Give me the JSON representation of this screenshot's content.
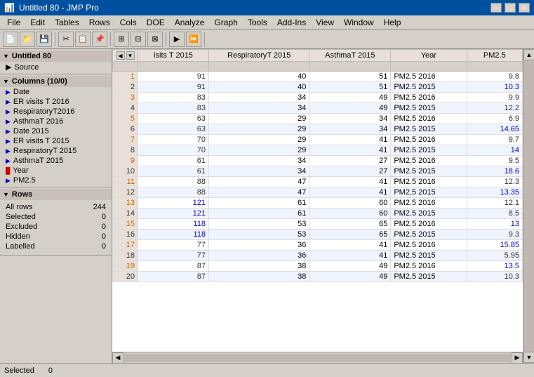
{
  "titleBar": {
    "title": "Untitled 80 - JMP Pro",
    "minBtn": "─",
    "maxBtn": "□",
    "closeBtn": "✕"
  },
  "menuBar": {
    "items": [
      "File",
      "Edit",
      "Tables",
      "Rows",
      "Cols",
      "DOE",
      "Analyze",
      "Graph",
      "Tools",
      "Add-Ins",
      "View",
      "Window",
      "Help"
    ]
  },
  "leftPanel": {
    "untitled": "Untitled 80",
    "source": "Source",
    "columnsHeader": "Columns (10/0)",
    "columns": [
      {
        "name": "Date",
        "icon": "tri-blue"
      },
      {
        "name": "ER visits T 2016",
        "icon": "tri-blue"
      },
      {
        "name": "RespiratoryT2016",
        "icon": "tri-blue"
      },
      {
        "name": "AsthmaT 2016",
        "icon": "tri-blue"
      },
      {
        "name": "Date 2015",
        "icon": "tri-blue"
      },
      {
        "name": "ER visits T 2015",
        "icon": "tri-blue"
      },
      {
        "name": "RespiratoryT 2015",
        "icon": "tri-blue"
      },
      {
        "name": "AsthmaT 2015",
        "icon": "tri-blue"
      },
      {
        "name": "Year",
        "icon": "bar-red"
      },
      {
        "name": "PM2.5",
        "icon": "tri-green"
      }
    ],
    "rowsHeader": "Rows",
    "rowStats": [
      {
        "label": "All rows",
        "value": 244
      },
      {
        "label": "Selected",
        "value": 0
      },
      {
        "label": "Excluded",
        "value": 0
      },
      {
        "label": "Hidden",
        "value": 0
      },
      {
        "label": "Labelled",
        "value": 0
      }
    ]
  },
  "table": {
    "headers": [
      "",
      "isits T 2015",
      "RespiratoryT 2015",
      "AsthmaT 2015",
      "Year",
      "PM2.5"
    ],
    "rows": [
      {
        "num": 1,
        "er": 91,
        "resp": 40,
        "asthma": 51,
        "year": "PM2.5 2016",
        "pm": 9.8,
        "numColor": "orange"
      },
      {
        "num": 2,
        "er": 91,
        "resp": 40,
        "asthma": 51,
        "year": "PM2.5 2015",
        "pm": 10.3,
        "numColor": "normal",
        "pmColor": "blue"
      },
      {
        "num": 3,
        "er": 83,
        "resp": 34,
        "asthma": 49,
        "year": "PM2.5 2016",
        "pm": 9.9,
        "numColor": "orange"
      },
      {
        "num": 4,
        "er": 83,
        "resp": 34,
        "asthma": 49,
        "year": "PM2.5 2015",
        "pm": 12.2,
        "numColor": "normal"
      },
      {
        "num": 5,
        "er": 63,
        "resp": 29,
        "asthma": 34,
        "year": "PM2.5 2016",
        "pm": 6.9,
        "numColor": "orange"
      },
      {
        "num": 6,
        "er": 63,
        "resp": 29,
        "asthma": 34,
        "year": "PM2.5 2015",
        "pm": 14.65,
        "numColor": "normal",
        "pmColor": "blue"
      },
      {
        "num": 7,
        "er": 70,
        "resp": 29,
        "asthma": 41,
        "year": "PM2.5 2016",
        "pm": 9.7,
        "numColor": "orange"
      },
      {
        "num": 8,
        "er": 70,
        "resp": 29,
        "asthma": 41,
        "year": "PM2.5 2015",
        "pm": 14,
        "numColor": "normal",
        "pmColor": "blue"
      },
      {
        "num": 9,
        "er": 61,
        "resp": 34,
        "asthma": 27,
        "year": "PM2.5 2016",
        "pm": 9.5,
        "numColor": "orange"
      },
      {
        "num": 10,
        "er": 61,
        "resp": 34,
        "asthma": 27,
        "year": "PM2.5 2015",
        "pm": 18.6,
        "numColor": "normal",
        "pmColor": "blue"
      },
      {
        "num": 11,
        "er": 88,
        "resp": 47,
        "asthma": 41,
        "year": "PM2.5 2016",
        "pm": 12.3,
        "numColor": "orange"
      },
      {
        "num": 12,
        "er": 88,
        "resp": 47,
        "asthma": 41,
        "year": "PM2.5 2015",
        "pm": 13.35,
        "numColor": "normal",
        "pmColor": "blue"
      },
      {
        "num": 13,
        "er": 121,
        "resp": 61,
        "asthma": 60,
        "year": "PM2.5 2016",
        "pm": 12.1,
        "numColor": "orange",
        "erColor": "blue"
      },
      {
        "num": 14,
        "er": 121,
        "resp": 61,
        "asthma": 60,
        "year": "PM2.5 2015",
        "pm": 8.5,
        "numColor": "normal",
        "erColor": "blue"
      },
      {
        "num": 15,
        "er": 118,
        "resp": 53,
        "asthma": 65,
        "year": "PM2.5 2016",
        "pm": 13,
        "numColor": "orange",
        "erColor": "blue",
        "pmColor": "blue"
      },
      {
        "num": 16,
        "er": 118,
        "resp": 53,
        "asthma": 65,
        "year": "PM2.5 2015",
        "pm": 9.3,
        "numColor": "normal",
        "erColor": "blue"
      },
      {
        "num": 17,
        "er": 77,
        "resp": 36,
        "asthma": 41,
        "year": "PM2.5 2016",
        "pm": 15.85,
        "numColor": "orange",
        "pmColor": "blue"
      },
      {
        "num": 18,
        "er": 77,
        "resp": 36,
        "asthma": 41,
        "year": "PM2.5 2015",
        "pm": 5.95,
        "numColor": "normal"
      },
      {
        "num": 19,
        "er": 87,
        "resp": 38,
        "asthma": 49,
        "year": "PM2.5 2016",
        "pm": 13.5,
        "numColor": "orange",
        "pmColor": "blue"
      },
      {
        "num": 20,
        "er": 87,
        "resp": 38,
        "asthma": 49,
        "year": "PM2.5 2015",
        "pm": 10.3,
        "numColor": "normal"
      }
    ]
  },
  "statusBar": {
    "selected": "Selected",
    "selectedCount": "0"
  }
}
